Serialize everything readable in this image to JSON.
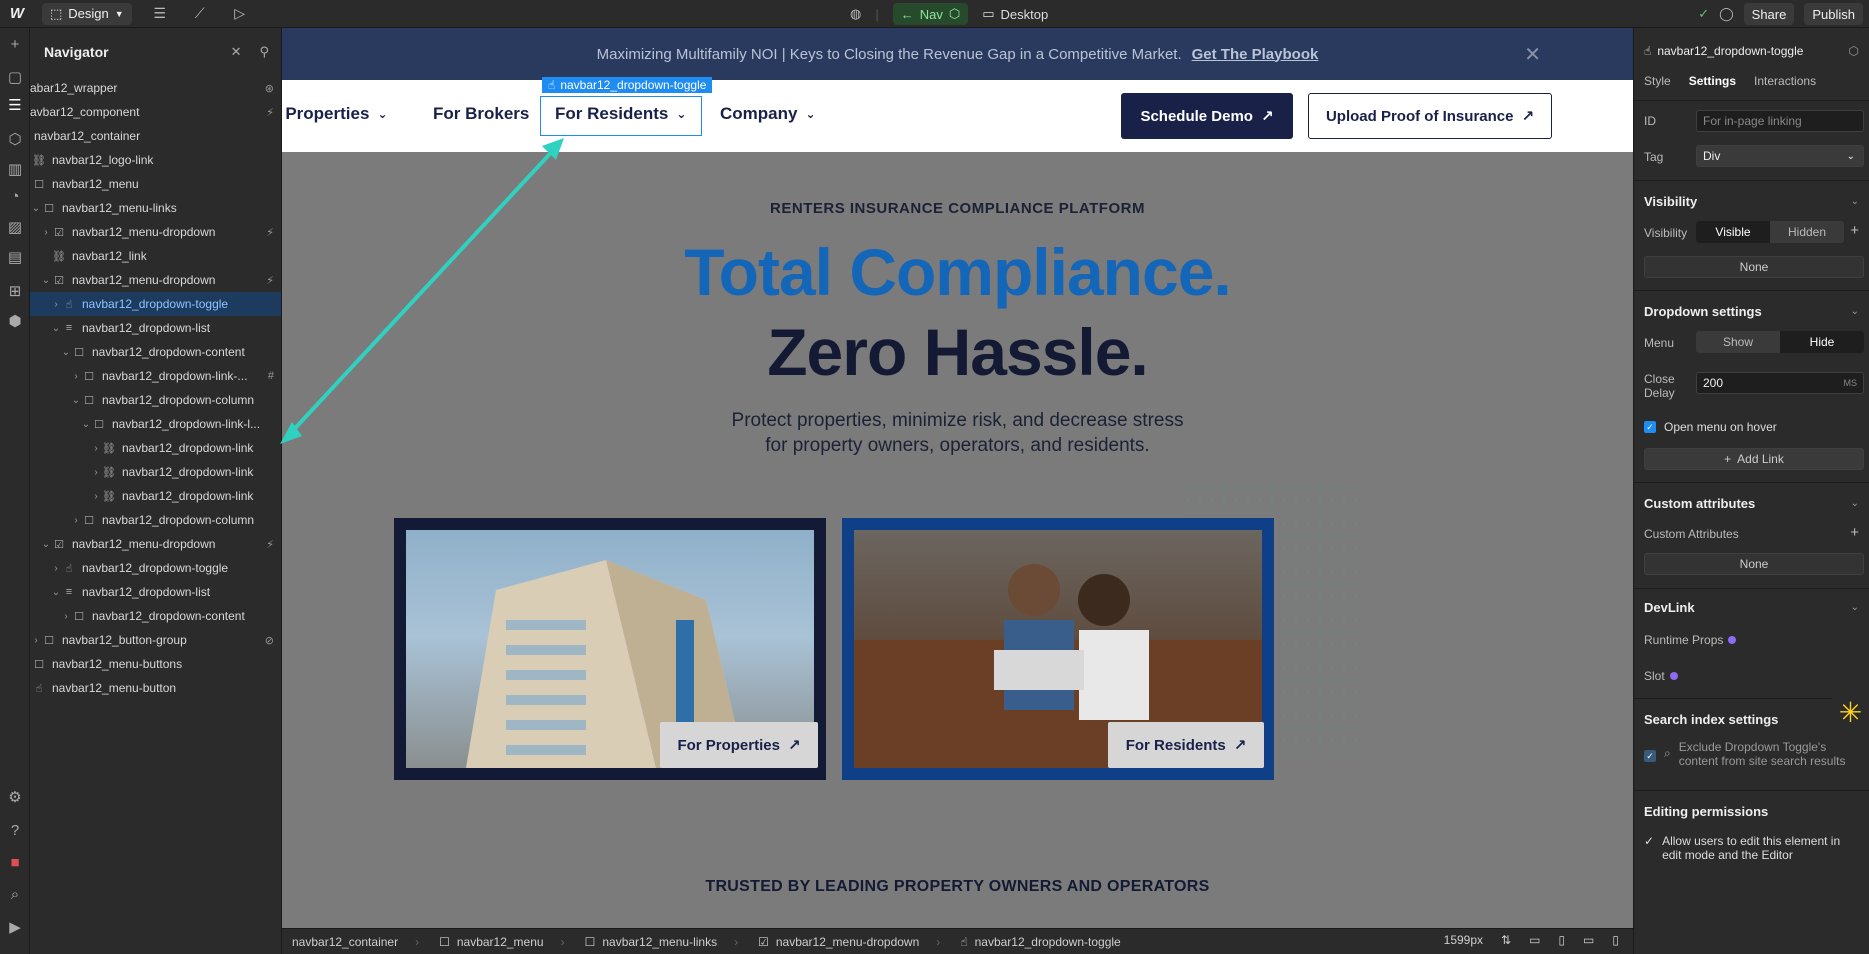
{
  "topbar": {
    "logo": "W",
    "mode_label": "Design",
    "nav_label": "Nav",
    "desktop_label": "Desktop",
    "share_label": "Share",
    "publish_label": "Publish"
  },
  "navigator": {
    "title": "Navigator",
    "items": [
      {
        "label": "abar12_wrapper",
        "badge": "⊛"
      },
      {
        "label": "avbar12_component",
        "badge": "⚡"
      },
      {
        "label": "navbar12_container",
        "badge": ""
      },
      {
        "label": "navbar12_logo-link",
        "badge": ""
      },
      {
        "label": "navbar12_menu",
        "badge": ""
      },
      {
        "label": "navbar12_menu-links",
        "badge": ""
      },
      {
        "label": "navbar12_menu-dropdown",
        "badge": "⚡"
      },
      {
        "label": "navbar12_link",
        "badge": ""
      },
      {
        "label": "navbar12_menu-dropdown",
        "badge": "⚡"
      },
      {
        "label": "navbar12_dropdown-toggle",
        "badge": ""
      },
      {
        "label": "navbar12_dropdown-list",
        "badge": ""
      },
      {
        "label": "navbar12_dropdown-content",
        "badge": ""
      },
      {
        "label": "navbar12_dropdown-link-...",
        "badge": "#"
      },
      {
        "label": "navbar12_dropdown-column",
        "badge": ""
      },
      {
        "label": "navbar12_dropdown-link-l...",
        "badge": ""
      },
      {
        "label": "navbar12_dropdown-link",
        "badge": ""
      },
      {
        "label": "navbar12_dropdown-link",
        "badge": ""
      },
      {
        "label": "navbar12_dropdown-link",
        "badge": ""
      },
      {
        "label": "navbar12_dropdown-column",
        "badge": ""
      },
      {
        "label": "navbar12_menu-dropdown",
        "badge": "⚡"
      },
      {
        "label": "navbar12_dropdown-toggle",
        "badge": ""
      },
      {
        "label": "navbar12_dropdown-list",
        "badge": ""
      },
      {
        "label": "navbar12_dropdown-content",
        "badge": ""
      },
      {
        "label": "navbar12_button-group",
        "badge": "⊘"
      },
      {
        "label": "navbar12_menu-buttons",
        "badge": ""
      },
      {
        "label": "navbar12_menu-button",
        "badge": ""
      }
    ]
  },
  "canvas": {
    "announcement": "Maximizing Multifamily NOI | Keys to Closing the Revenue Gap in a Competitive Market.",
    "announcement_link": "Get The Playbook",
    "menu": [
      "r Properties",
      "For Brokers",
      "For Residents",
      "Company"
    ],
    "selected_element_label": "navbar12_dropdown-toggle",
    "btn_demo": "Schedule Demo",
    "btn_upload": "Upload Proof of Insurance",
    "eyebrow": "RENTERS INSURANCE COMPLIANCE PLATFORM",
    "headline_1": "Total Compliance.",
    "headline_2": "Zero Hassle.",
    "subhead": "Protect properties, minimize risk, and decrease stress for property owners, operators, and residents.",
    "card_1_cta": "For Properties",
    "card_2_cta": "For Residents",
    "trusted": "TRUSTED BY LEADING PROPERTY OWNERS AND OPERATORS"
  },
  "breadcrumbs": {
    "items": [
      "navbar12_container",
      "navbar12_menu",
      "navbar12_menu-links",
      "navbar12_menu-dropdown",
      "navbar12_dropdown-toggle"
    ],
    "width_readout": "1599px"
  },
  "panel": {
    "selected": "navbar12_dropdown-toggle",
    "tabs": [
      "Style",
      "Settings",
      "Interactions"
    ],
    "id_label": "ID",
    "id_placeholder": "For in-page linking",
    "tag_label": "Tag",
    "tag_value": "Div",
    "visibility_section": "Visibility",
    "visibility_label": "Visibility",
    "visible": "Visible",
    "hidden": "Hidden",
    "none": "None",
    "dropdown_section": "Dropdown settings",
    "menu_label": "Menu",
    "show": "Show",
    "hide": "Hide",
    "close_delay_label_1": "Close",
    "close_delay_label_2": "Delay",
    "close_delay_value": "200",
    "close_delay_unit": "MS",
    "open_on_hover": "Open menu on hover",
    "add_link": "Add Link",
    "custom_attr_section": "Custom attributes",
    "custom_attr_label": "Custom Attributes",
    "devlink_section": "DevLink",
    "runtime_props": "Runtime Props",
    "slot": "Slot",
    "search_section": "Search index settings",
    "search_exclude": "Exclude Dropdown Toggle's content from site search results",
    "editing_section": "Editing permissions",
    "editing_allow": "Allow users to edit this element in edit mode and the Editor"
  }
}
